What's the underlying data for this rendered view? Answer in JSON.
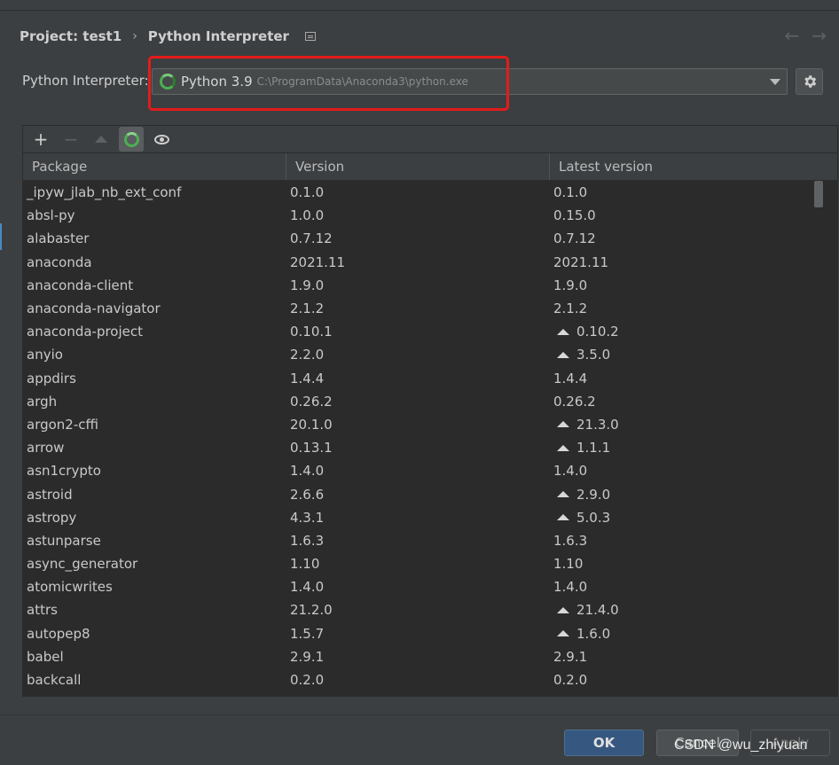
{
  "breadcrumb": {
    "project": "Project: test1",
    "page": "Python Interpreter"
  },
  "interpreter": {
    "label": "Python Interpreter:",
    "name": "Python 3.9",
    "path": "C:\\ProgramData\\Anaconda3\\python.exe"
  },
  "table": {
    "headers": [
      "Package",
      "Version",
      "Latest version"
    ],
    "rows": [
      {
        "package": "_ipyw_jlab_nb_ext_conf",
        "version": "0.1.0",
        "latest": "0.1.0",
        "upgrade": false
      },
      {
        "package": "absl-py",
        "version": "1.0.0",
        "latest": "0.15.0",
        "upgrade": false
      },
      {
        "package": "alabaster",
        "version": "0.7.12",
        "latest": "0.7.12",
        "upgrade": false
      },
      {
        "package": "anaconda",
        "version": "2021.11",
        "latest": "2021.11",
        "upgrade": false
      },
      {
        "package": "anaconda-client",
        "version": "1.9.0",
        "latest": "1.9.0",
        "upgrade": false
      },
      {
        "package": "anaconda-navigator",
        "version": "2.1.2",
        "latest": "2.1.2",
        "upgrade": false
      },
      {
        "package": "anaconda-project",
        "version": "0.10.1",
        "latest": "0.10.2",
        "upgrade": true
      },
      {
        "package": "anyio",
        "version": "2.2.0",
        "latest": "3.5.0",
        "upgrade": true
      },
      {
        "package": "appdirs",
        "version": "1.4.4",
        "latest": "1.4.4",
        "upgrade": false
      },
      {
        "package": "argh",
        "version": "0.26.2",
        "latest": "0.26.2",
        "upgrade": false
      },
      {
        "package": "argon2-cffi",
        "version": "20.1.0",
        "latest": "21.3.0",
        "upgrade": true
      },
      {
        "package": "arrow",
        "version": "0.13.1",
        "latest": "1.1.1",
        "upgrade": true
      },
      {
        "package": "asn1crypto",
        "version": "1.4.0",
        "latest": "1.4.0",
        "upgrade": false
      },
      {
        "package": "astroid",
        "version": "2.6.6",
        "latest": "2.9.0",
        "upgrade": true
      },
      {
        "package": "astropy",
        "version": "4.3.1",
        "latest": "5.0.3",
        "upgrade": true
      },
      {
        "package": "astunparse",
        "version": "1.6.3",
        "latest": "1.6.3",
        "upgrade": false
      },
      {
        "package": "async_generator",
        "version": "1.10",
        "latest": "1.10",
        "upgrade": false
      },
      {
        "package": "atomicwrites",
        "version": "1.4.0",
        "latest": "1.4.0",
        "upgrade": false
      },
      {
        "package": "attrs",
        "version": "21.2.0",
        "latest": "21.4.0",
        "upgrade": true
      },
      {
        "package": "autopep8",
        "version": "1.5.7",
        "latest": "1.6.0",
        "upgrade": true
      },
      {
        "package": "babel",
        "version": "2.9.1",
        "latest": "2.9.1",
        "upgrade": false
      },
      {
        "package": "backcall",
        "version": "0.2.0",
        "latest": "0.2.0",
        "upgrade": false
      }
    ]
  },
  "buttons": {
    "ok": "OK",
    "cancel": "Cancel",
    "apply": "Apply"
  },
  "watermark": "CSDN @wu_zhiyuan",
  "colors": {
    "highlight": "#e51b1b",
    "accent": "#365880",
    "spinner": "#4caf50"
  }
}
